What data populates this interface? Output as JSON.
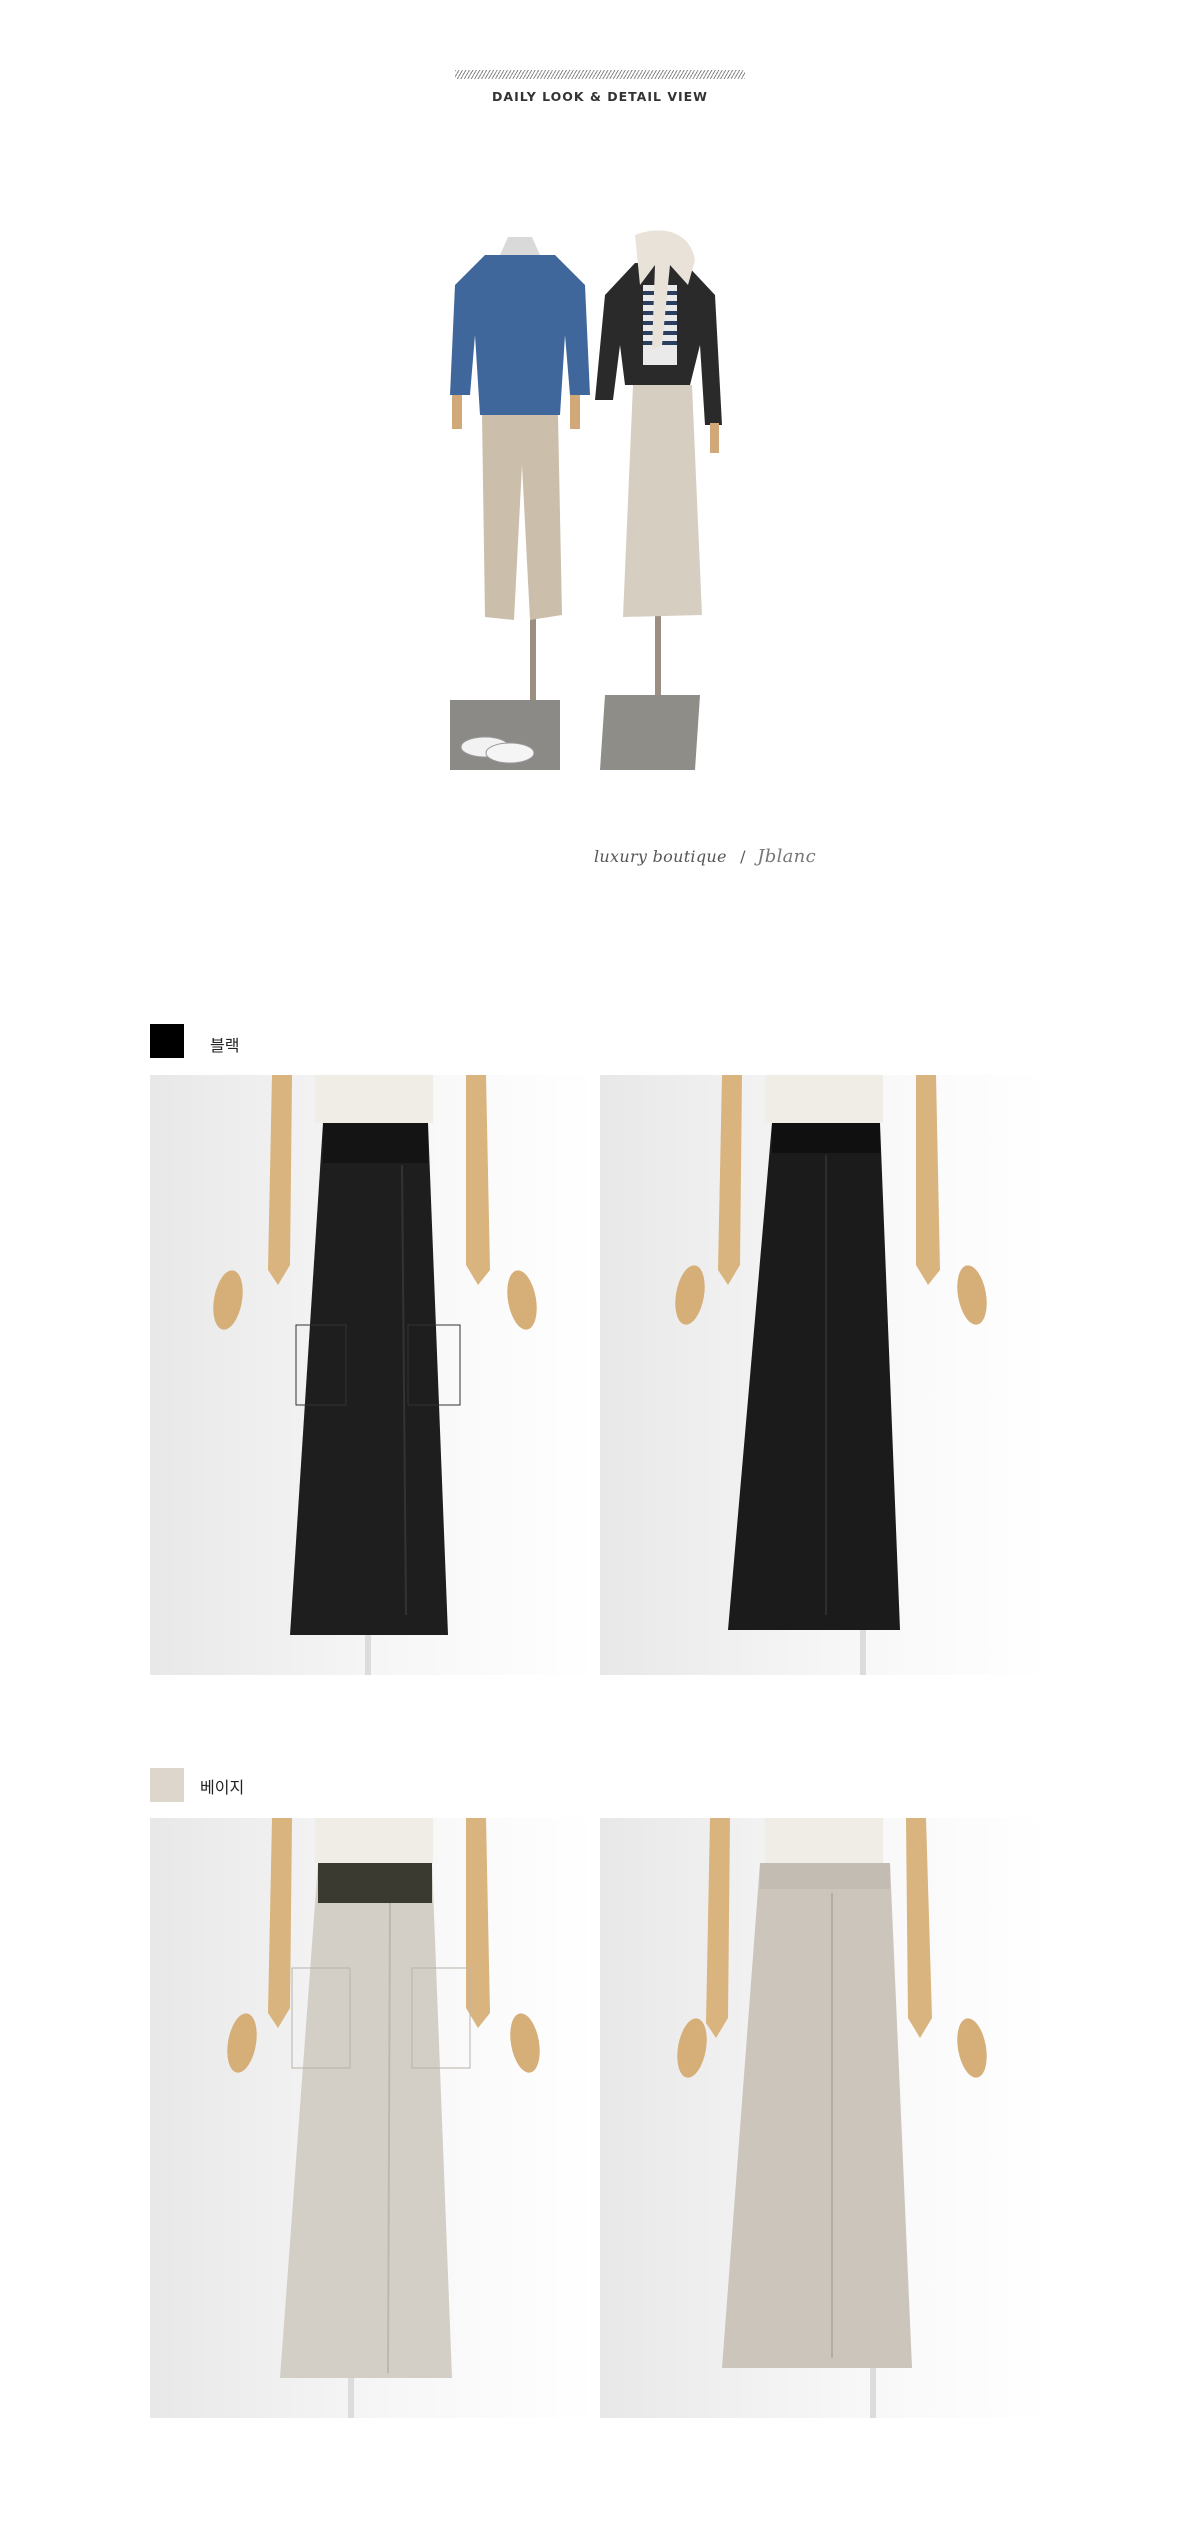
{
  "header": {
    "title": "DAILY LOOK & DETAIL VIEW"
  },
  "brand": {
    "text": "luxury boutique",
    "separator": "/",
    "signature": "Jblanc"
  },
  "colors": [
    {
      "label": "블랙",
      "swatch": "#000000",
      "skirt": "#1e1e1e",
      "band": "#151515"
    },
    {
      "label": "베이지",
      "swatch": "#ddd6cc",
      "skirt": "#d4cfc6",
      "band": "#3b3a30"
    }
  ],
  "icons": {
    "hatch": "hatched-divider-icon"
  }
}
